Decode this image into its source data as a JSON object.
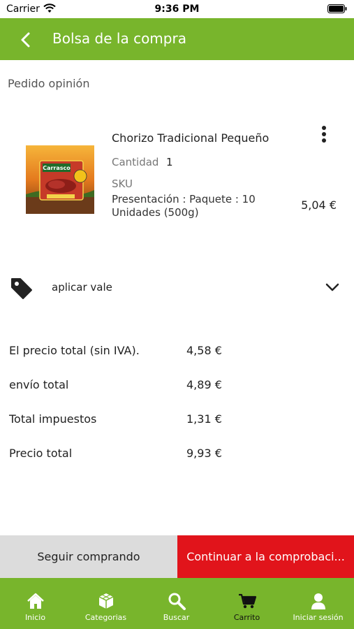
{
  "status": {
    "carrier": "Carrier",
    "time": "9:36 PM"
  },
  "header": {
    "title": "Bolsa de la compra",
    "back_icon": "chevron-left-icon"
  },
  "section_label": "Pedido opinión",
  "item": {
    "name": "Chorizo Tradicional Pequeño",
    "quantity_label": "Cantidad",
    "quantity_value": "1",
    "sku_label": "SKU",
    "presentation": "Presentación : Paquete : 10 Unidades (500g)",
    "price": "5,04 €",
    "image_brand": "Carrasco",
    "menu_icon": "more-vertical-icon"
  },
  "voucher": {
    "label": "aplicar vale",
    "icon": "tag-icon",
    "expand_icon": "chevron-down-icon"
  },
  "summary": [
    {
      "label": "El precio total (sin IVA).",
      "value": "4,58 €"
    },
    {
      "label": "envío total",
      "value": "4,89 €"
    },
    {
      "label": "Total impuestos",
      "value": "1,31 €"
    },
    {
      "label": "Precio total",
      "value": "9,93 €"
    }
  ],
  "actions": {
    "continue_shopping": "Seguir comprando",
    "checkout": "Continuar a la comprobaci..."
  },
  "tabs": [
    {
      "label": "Inicio",
      "icon": "home-icon",
      "active": false
    },
    {
      "label": "Categorias",
      "icon": "cube-icon",
      "active": false
    },
    {
      "label": "Buscar",
      "icon": "search-icon",
      "active": false
    },
    {
      "label": "Carrito",
      "icon": "cart-icon",
      "active": true
    },
    {
      "label": "Iniciar sesión",
      "icon": "user-icon",
      "active": false
    }
  ],
  "colors": {
    "primary_green": "#78b52c",
    "checkout_red": "#e1141b",
    "secondary_gray": "#dcdcdc"
  }
}
